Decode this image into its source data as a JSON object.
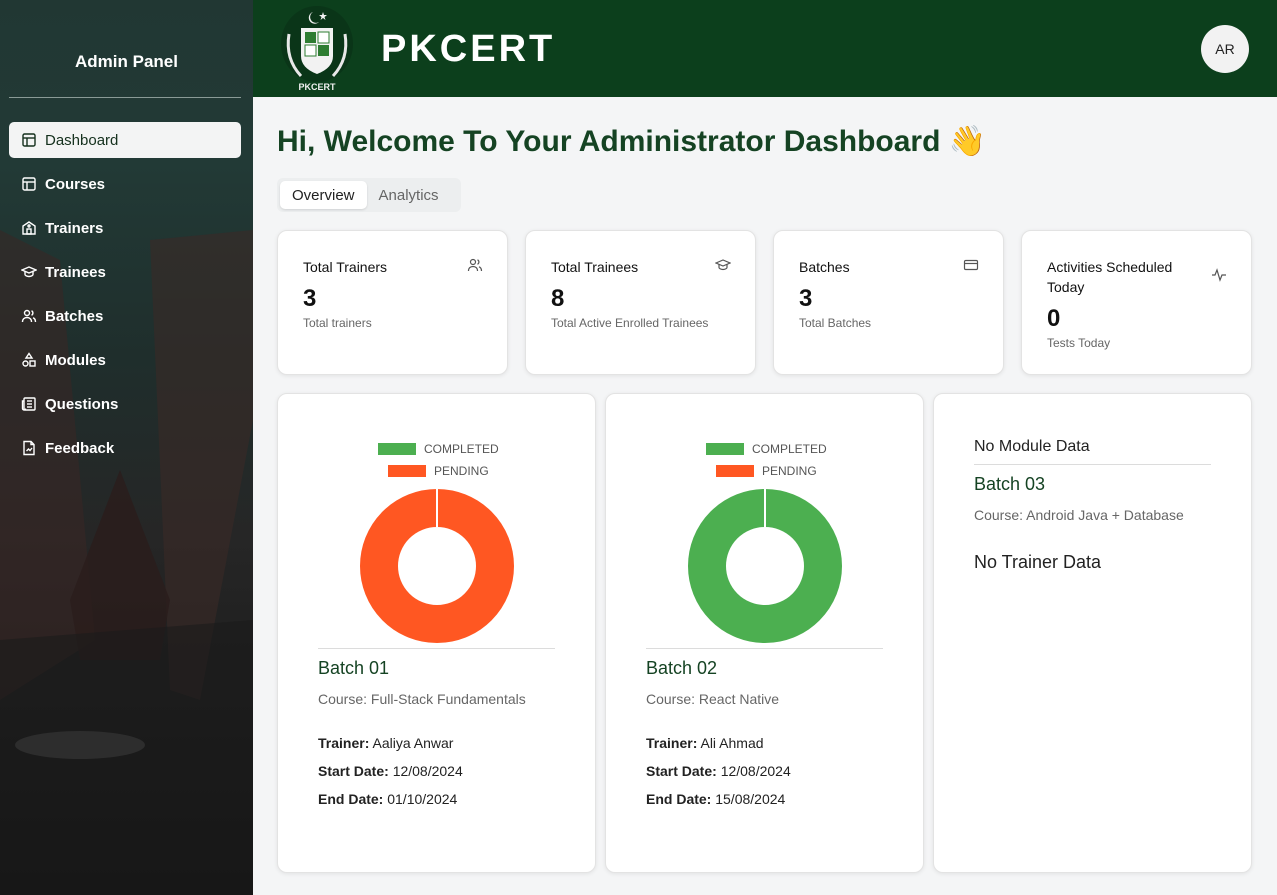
{
  "sidebar": {
    "title": "Admin Panel",
    "items": [
      {
        "label": "Dashboard",
        "icon": "layout-icon",
        "active": true
      },
      {
        "label": "Courses",
        "icon": "layout-icon",
        "active": false
      },
      {
        "label": "Trainers",
        "icon": "building-icon",
        "active": false
      },
      {
        "label": "Trainees",
        "icon": "graduation-cap-icon",
        "active": false
      },
      {
        "label": "Batches",
        "icon": "users-icon",
        "active": false
      },
      {
        "label": "Modules",
        "icon": "shapes-icon",
        "active": false
      },
      {
        "label": "Questions",
        "icon": "newspaper-icon",
        "active": false
      },
      {
        "label": "Feedback",
        "icon": "file-chart-icon",
        "active": false
      }
    ]
  },
  "header": {
    "brand": "PKCERT",
    "logo_text": "PKCERT",
    "avatar_initials": "AR",
    "color": "#0c3f1c"
  },
  "main": {
    "welcome": "Hi, Welcome To Your Administrator Dashboard 👋",
    "tabs": [
      {
        "label": "Overview",
        "active": true
      },
      {
        "label": "Analytics",
        "active": false
      }
    ],
    "stats": [
      {
        "title": "Total Trainers",
        "value": "3",
        "sub": "Total trainers",
        "icon": "users-icon"
      },
      {
        "title": "Total Trainees",
        "value": "8",
        "sub": "Total Active Enrolled Trainees",
        "icon": "graduation-cap-icon"
      },
      {
        "title": "Batches",
        "value": "3",
        "sub": "Total Batches",
        "icon": "credit-card-icon"
      },
      {
        "title": "Activities Scheduled Today",
        "value": "0",
        "sub": "Tests Today",
        "icon": "activity-icon"
      }
    ],
    "batches": [
      {
        "name": "Batch 01",
        "course": "Course: Full-Stack Fundamentals",
        "trainer_label": "Trainer:",
        "trainer": "Aaliya Anwar",
        "start_label": "Start Date:",
        "start": "12/08/2024",
        "end_label": "End Date:",
        "end": "01/10/2024",
        "legend": [
          "COMPLETED",
          "PENDING"
        ],
        "completed_fraction": 0,
        "pending_fraction": 1
      },
      {
        "name": "Batch 02",
        "course": "Course: React Native",
        "trainer_label": "Trainer:",
        "trainer": "Ali Ahmad",
        "start_label": "Start Date:",
        "start": "12/08/2024",
        "end_label": "End Date:",
        "end": "15/08/2024",
        "legend": [
          "COMPLETED",
          "PENDING"
        ],
        "completed_fraction": 1,
        "pending_fraction": 0
      },
      {
        "no_module": "No Module Data",
        "name": "Batch 03",
        "course": "Course: Android Java + Database",
        "no_trainer": "No Trainer Data"
      }
    ],
    "colors": {
      "completed": "#4caf50",
      "pending": "#ff5722",
      "accent": "#154323"
    }
  }
}
